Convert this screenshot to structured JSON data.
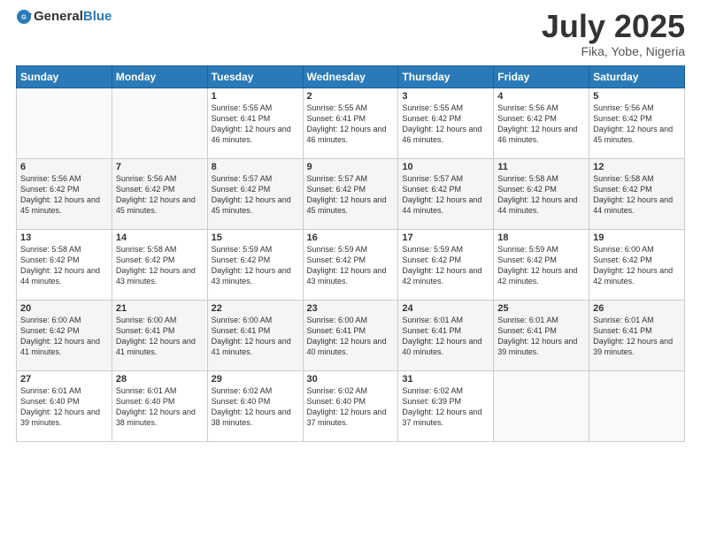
{
  "header": {
    "logo_general": "General",
    "logo_blue": "Blue",
    "title": "July 2025",
    "location": "Fika, Yobe, Nigeria"
  },
  "weekdays": [
    "Sunday",
    "Monday",
    "Tuesday",
    "Wednesday",
    "Thursday",
    "Friday",
    "Saturday"
  ],
  "weeks": [
    [
      {
        "day": "",
        "info": ""
      },
      {
        "day": "",
        "info": ""
      },
      {
        "day": "1",
        "info": "Sunrise: 5:55 AM\nSunset: 6:41 PM\nDaylight: 12 hours and 46 minutes."
      },
      {
        "day": "2",
        "info": "Sunrise: 5:55 AM\nSunset: 6:41 PM\nDaylight: 12 hours and 46 minutes."
      },
      {
        "day": "3",
        "info": "Sunrise: 5:55 AM\nSunset: 6:42 PM\nDaylight: 12 hours and 46 minutes."
      },
      {
        "day": "4",
        "info": "Sunrise: 5:56 AM\nSunset: 6:42 PM\nDaylight: 12 hours and 46 minutes."
      },
      {
        "day": "5",
        "info": "Sunrise: 5:56 AM\nSunset: 6:42 PM\nDaylight: 12 hours and 45 minutes."
      }
    ],
    [
      {
        "day": "6",
        "info": "Sunrise: 5:56 AM\nSunset: 6:42 PM\nDaylight: 12 hours and 45 minutes."
      },
      {
        "day": "7",
        "info": "Sunrise: 5:56 AM\nSunset: 6:42 PM\nDaylight: 12 hours and 45 minutes."
      },
      {
        "day": "8",
        "info": "Sunrise: 5:57 AM\nSunset: 6:42 PM\nDaylight: 12 hours and 45 minutes."
      },
      {
        "day": "9",
        "info": "Sunrise: 5:57 AM\nSunset: 6:42 PM\nDaylight: 12 hours and 45 minutes."
      },
      {
        "day": "10",
        "info": "Sunrise: 5:57 AM\nSunset: 6:42 PM\nDaylight: 12 hours and 44 minutes."
      },
      {
        "day": "11",
        "info": "Sunrise: 5:58 AM\nSunset: 6:42 PM\nDaylight: 12 hours and 44 minutes."
      },
      {
        "day": "12",
        "info": "Sunrise: 5:58 AM\nSunset: 6:42 PM\nDaylight: 12 hours and 44 minutes."
      }
    ],
    [
      {
        "day": "13",
        "info": "Sunrise: 5:58 AM\nSunset: 6:42 PM\nDaylight: 12 hours and 44 minutes."
      },
      {
        "day": "14",
        "info": "Sunrise: 5:58 AM\nSunset: 6:42 PM\nDaylight: 12 hours and 43 minutes."
      },
      {
        "day": "15",
        "info": "Sunrise: 5:59 AM\nSunset: 6:42 PM\nDaylight: 12 hours and 43 minutes."
      },
      {
        "day": "16",
        "info": "Sunrise: 5:59 AM\nSunset: 6:42 PM\nDaylight: 12 hours and 43 minutes."
      },
      {
        "day": "17",
        "info": "Sunrise: 5:59 AM\nSunset: 6:42 PM\nDaylight: 12 hours and 42 minutes."
      },
      {
        "day": "18",
        "info": "Sunrise: 5:59 AM\nSunset: 6:42 PM\nDaylight: 12 hours and 42 minutes."
      },
      {
        "day": "19",
        "info": "Sunrise: 6:00 AM\nSunset: 6:42 PM\nDaylight: 12 hours and 42 minutes."
      }
    ],
    [
      {
        "day": "20",
        "info": "Sunrise: 6:00 AM\nSunset: 6:42 PM\nDaylight: 12 hours and 41 minutes."
      },
      {
        "day": "21",
        "info": "Sunrise: 6:00 AM\nSunset: 6:41 PM\nDaylight: 12 hours and 41 minutes."
      },
      {
        "day": "22",
        "info": "Sunrise: 6:00 AM\nSunset: 6:41 PM\nDaylight: 12 hours and 41 minutes."
      },
      {
        "day": "23",
        "info": "Sunrise: 6:00 AM\nSunset: 6:41 PM\nDaylight: 12 hours and 40 minutes."
      },
      {
        "day": "24",
        "info": "Sunrise: 6:01 AM\nSunset: 6:41 PM\nDaylight: 12 hours and 40 minutes."
      },
      {
        "day": "25",
        "info": "Sunrise: 6:01 AM\nSunset: 6:41 PM\nDaylight: 12 hours and 39 minutes."
      },
      {
        "day": "26",
        "info": "Sunrise: 6:01 AM\nSunset: 6:41 PM\nDaylight: 12 hours and 39 minutes."
      }
    ],
    [
      {
        "day": "27",
        "info": "Sunrise: 6:01 AM\nSunset: 6:40 PM\nDaylight: 12 hours and 39 minutes."
      },
      {
        "day": "28",
        "info": "Sunrise: 6:01 AM\nSunset: 6:40 PM\nDaylight: 12 hours and 38 minutes."
      },
      {
        "day": "29",
        "info": "Sunrise: 6:02 AM\nSunset: 6:40 PM\nDaylight: 12 hours and 38 minutes."
      },
      {
        "day": "30",
        "info": "Sunrise: 6:02 AM\nSunset: 6:40 PM\nDaylight: 12 hours and 37 minutes."
      },
      {
        "day": "31",
        "info": "Sunrise: 6:02 AM\nSunset: 6:39 PM\nDaylight: 12 hours and 37 minutes."
      },
      {
        "day": "",
        "info": ""
      },
      {
        "day": "",
        "info": ""
      }
    ]
  ]
}
